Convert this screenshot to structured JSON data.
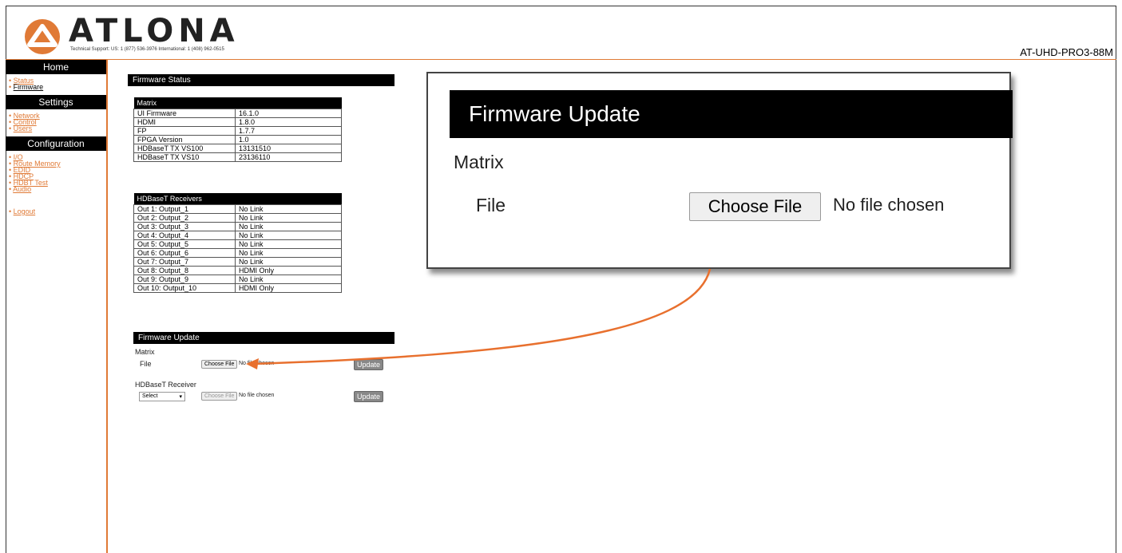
{
  "brand": {
    "name": "ATLONA",
    "accent": "#e07a36"
  },
  "support": {
    "text": "Technical Support:   US: 1 (877) 536-3976    International: 1 (408) 962-0515"
  },
  "model": "AT-UHD-PRO3-88M",
  "sidebar": {
    "home": {
      "title": "Home",
      "items": [
        "Status",
        "Firmware"
      ]
    },
    "settings": {
      "title": "Settings",
      "items": [
        "Network",
        "Control",
        "Users"
      ]
    },
    "configuration": {
      "title": "Configuration",
      "items": [
        "I/O",
        "Route Memory",
        "EDID",
        "HDCP",
        "HDBT Test",
        "Audio"
      ]
    },
    "logout": "Logout"
  },
  "firmware_status": {
    "title": "Firmware Status",
    "matrix": {
      "title": "Matrix",
      "rows": [
        [
          "UI Firmware",
          "16.1.0"
        ],
        [
          "HDMI",
          "1.8.0"
        ],
        [
          "FP",
          "1.7.7"
        ],
        [
          "FPGA Version",
          "1.0"
        ],
        [
          "HDBaseT TX VS100",
          "13131510"
        ],
        [
          "HDBaseT TX VS10",
          "23136110"
        ]
      ]
    },
    "receivers": {
      "title": "HDBaseT Receivers",
      "rows": [
        [
          "Out 1: Output_1",
          "No Link"
        ],
        [
          "Out 2: Output_2",
          "No Link"
        ],
        [
          "Out 3: Output_3",
          "No Link"
        ],
        [
          "Out 4: Output_4",
          "No Link"
        ],
        [
          "Out 5: Output_5",
          "No Link"
        ],
        [
          "Out 6: Output_6",
          "No Link"
        ],
        [
          "Out 7: Output_7",
          "No Link"
        ],
        [
          "Out 8: Output_8",
          "HDMI Only"
        ],
        [
          "Out 9: Output_9",
          "No Link"
        ],
        [
          "Out 10: Output_10",
          "HDMI Only"
        ]
      ]
    }
  },
  "firmware_update": {
    "title": "Firmware Update",
    "matrix_label": "Matrix",
    "file_label": "File",
    "choose_file": "Choose File",
    "no_file": "No file chosen",
    "update": "Update",
    "receiver_label": "HDBaseT Receiver",
    "select_value": "Select"
  },
  "callout": {
    "title": "Firmware Update",
    "matrix_label": "Matrix",
    "file_label": "File",
    "choose_file": "Choose File",
    "no_file": "No file chosen"
  }
}
